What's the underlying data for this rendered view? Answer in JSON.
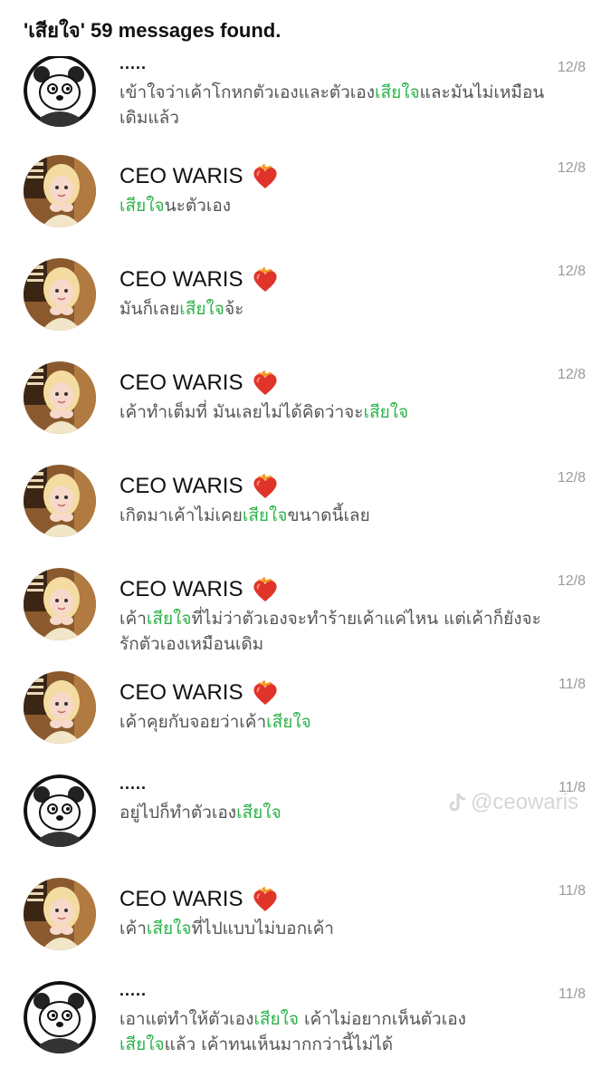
{
  "search": {
    "title": "'เสียใจ' 59 messages found."
  },
  "watermark": {
    "text": "@ceowaris",
    "icon": "tiktok-icon"
  },
  "colors": {
    "highlight": "#2db34a",
    "date": "#9a9a9a",
    "preview": "#555555"
  },
  "results": [
    {
      "avatar": "panda-avatar",
      "name": ".....",
      "date": "12/8",
      "segments": [
        {
          "text": "เข้าใจว่าเค้าโกหกตัวเองและตัวเอง",
          "hl": false
        },
        {
          "text": "เสียใจ",
          "hl": true
        },
        {
          "text": "และมันไม่เหมือนเดิมแล้ว",
          "hl": false
        }
      ]
    },
    {
      "avatar": "photo-avatar",
      "name": "CEO WARIS",
      "emoji": "heart-on-fire-icon",
      "date": "12/8",
      "segments": [
        {
          "text": "เสียใจ",
          "hl": true
        },
        {
          "text": "นะตัวเอง",
          "hl": false
        }
      ]
    },
    {
      "avatar": "photo-avatar",
      "name": "CEO WARIS",
      "emoji": "heart-on-fire-icon",
      "date": "12/8",
      "segments": [
        {
          "text": "มันก็เลย",
          "hl": false
        },
        {
          "text": "เสียใจ",
          "hl": true
        },
        {
          "text": "จ้ะ",
          "hl": false
        }
      ]
    },
    {
      "avatar": "photo-avatar",
      "name": "CEO WARIS",
      "emoji": "heart-on-fire-icon",
      "date": "12/8",
      "segments": [
        {
          "text": "เค้าทำเต็มที่ มันเลยไม่ได้คิดว่าจะ",
          "hl": false
        },
        {
          "text": "เสียใจ",
          "hl": true
        }
      ]
    },
    {
      "avatar": "photo-avatar",
      "name": "CEO WARIS",
      "emoji": "heart-on-fire-icon",
      "date": "12/8",
      "segments": [
        {
          "text": "เกิดมาเค้าไม่เคย",
          "hl": false
        },
        {
          "text": "เสียใจ",
          "hl": true
        },
        {
          "text": "ขนาดนี้เลย",
          "hl": false
        }
      ]
    },
    {
      "avatar": "photo-avatar",
      "name": "CEO WARIS",
      "emoji": "heart-on-fire-icon",
      "date": "12/8",
      "segments": [
        {
          "text": "เค้า",
          "hl": false
        },
        {
          "text": "เสียใจ",
          "hl": true
        },
        {
          "text": "ที่ไม่ว่าตัวเองจะทำร้ายเค้าแค่ไหน แต่เค้าก็ยังจะรักตัวเองเหมือนเดิม",
          "hl": false
        }
      ]
    },
    {
      "avatar": "photo-avatar",
      "name": "CEO WARIS",
      "emoji": "heart-on-fire-icon",
      "date": "11/8",
      "segments": [
        {
          "text": "เค้าคุยกับจอยว่าเค้า",
          "hl": false
        },
        {
          "text": "เสียใจ",
          "hl": true
        }
      ]
    },
    {
      "avatar": "panda-avatar",
      "name": ".....",
      "date": "11/8",
      "segments": [
        {
          "text": "อยู่ไปก็ทำตัวเอง",
          "hl": false
        },
        {
          "text": "เสียใจ",
          "hl": true
        }
      ]
    },
    {
      "avatar": "photo-avatar",
      "name": "CEO WARIS",
      "emoji": "heart-on-fire-icon",
      "date": "11/8",
      "segments": [
        {
          "text": "เค้า",
          "hl": false
        },
        {
          "text": "เสียใจ",
          "hl": true
        },
        {
          "text": "ที่ไปแบบไม่บอกเค้า",
          "hl": false
        }
      ]
    },
    {
      "avatar": "panda-avatar",
      "name": ".....",
      "date": "11/8",
      "segments": [
        {
          "text": "เอาแต่ทำให้ตัวเอง",
          "hl": false
        },
        {
          "text": "เสียใจ",
          "hl": true
        },
        {
          "text": " เค้าไม่อยากเห็นตัวเอง",
          "hl": false
        },
        {
          "text": "\n",
          "hl": false
        },
        {
          "text": "เสียใจ",
          "hl": true
        },
        {
          "text": "แล้ว เค้าทนเห็นมากกว่านี้ไม่ได้",
          "hl": false
        }
      ]
    }
  ]
}
